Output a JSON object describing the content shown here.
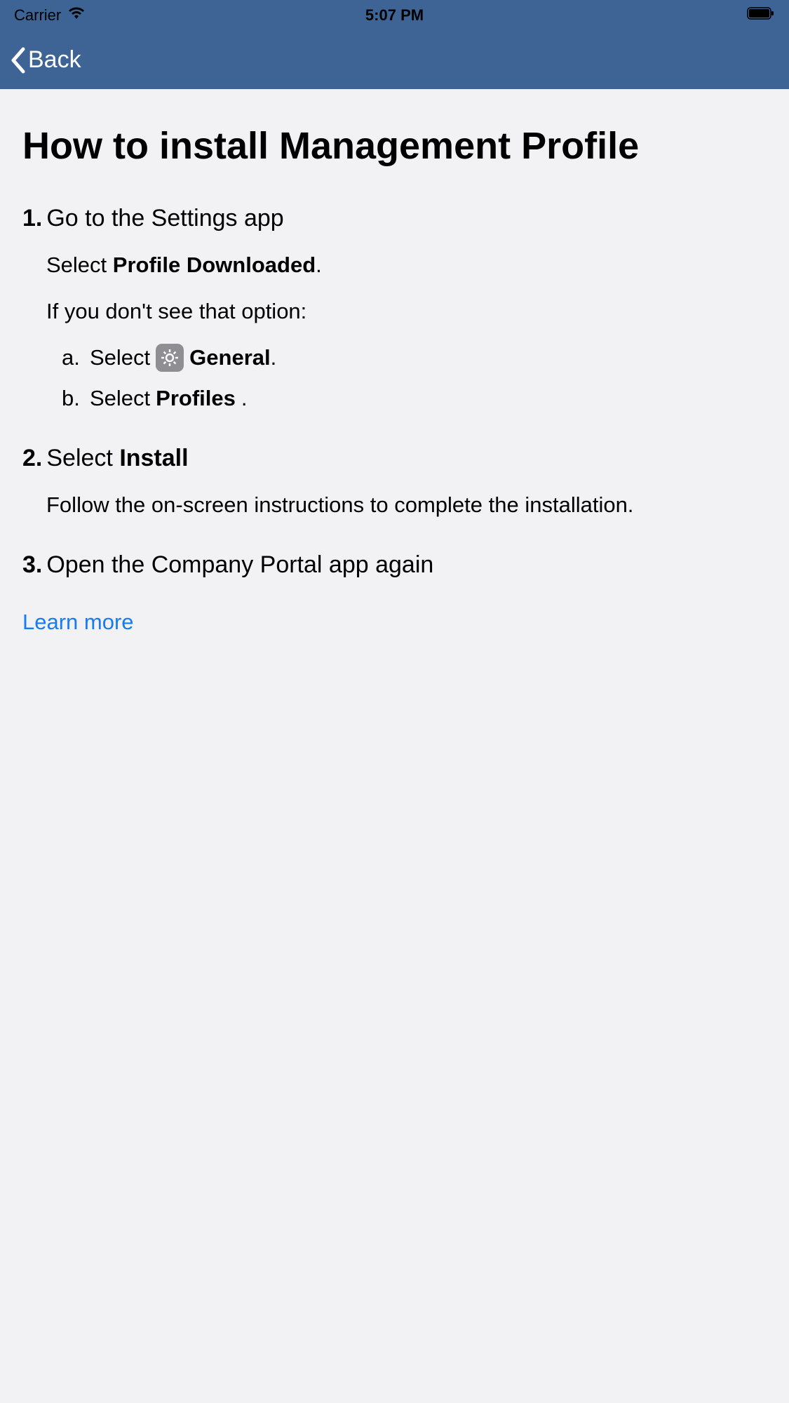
{
  "statusBar": {
    "carrier": "Carrier",
    "time": "5:07 PM"
  },
  "navBar": {
    "backLabel": "Back"
  },
  "title": "How to install Management Profile",
  "steps": {
    "s1": {
      "number": "1.",
      "title": "Go to the Settings app",
      "line1_pre": "Select ",
      "line1_bold": "Profile Downloaded",
      "line1_post": ".",
      "line2": "If you don't see that option:",
      "a_letter": "a.",
      "a_pre": "Select",
      "a_bold": "General",
      "a_post": ".",
      "b_letter": "b.",
      "b_pre": "Select ",
      "b_bold": "Profiles",
      "b_post": "."
    },
    "s2": {
      "number": "2.",
      "title_pre": "Select ",
      "title_bold": "Install",
      "body": "Follow the on-screen instructions to complete the installation."
    },
    "s3": {
      "number": "3.",
      "title": "Open the Company Portal app again"
    }
  },
  "learnMore": "Learn more"
}
